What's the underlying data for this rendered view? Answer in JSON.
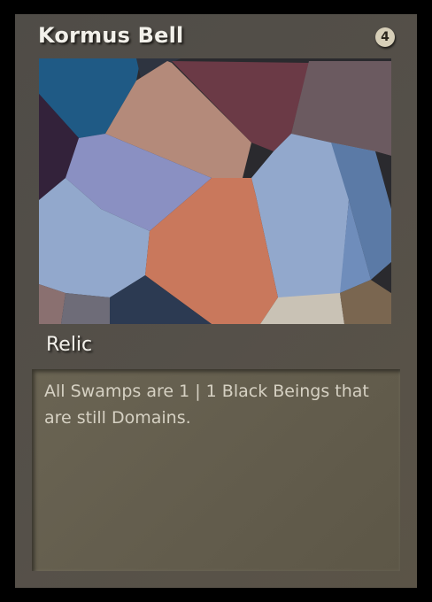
{
  "card": {
    "title": "Kormus Bell",
    "cost": "4",
    "type_line": "Relic",
    "rules_text": "All Swamps are 1 | 1 Black Beings that are still Domains."
  },
  "art": {
    "icon": "voronoi-abstract-art",
    "palette": [
      "#1f5a85",
      "#b48a7a",
      "#6b3a46",
      "#6b5a60",
      "#33223a",
      "#8a90c2",
      "#92a8cc",
      "#c9785c",
      "#5b7aa6",
      "#2c3a52",
      "#c9c2b5",
      "#7a6650"
    ]
  }
}
